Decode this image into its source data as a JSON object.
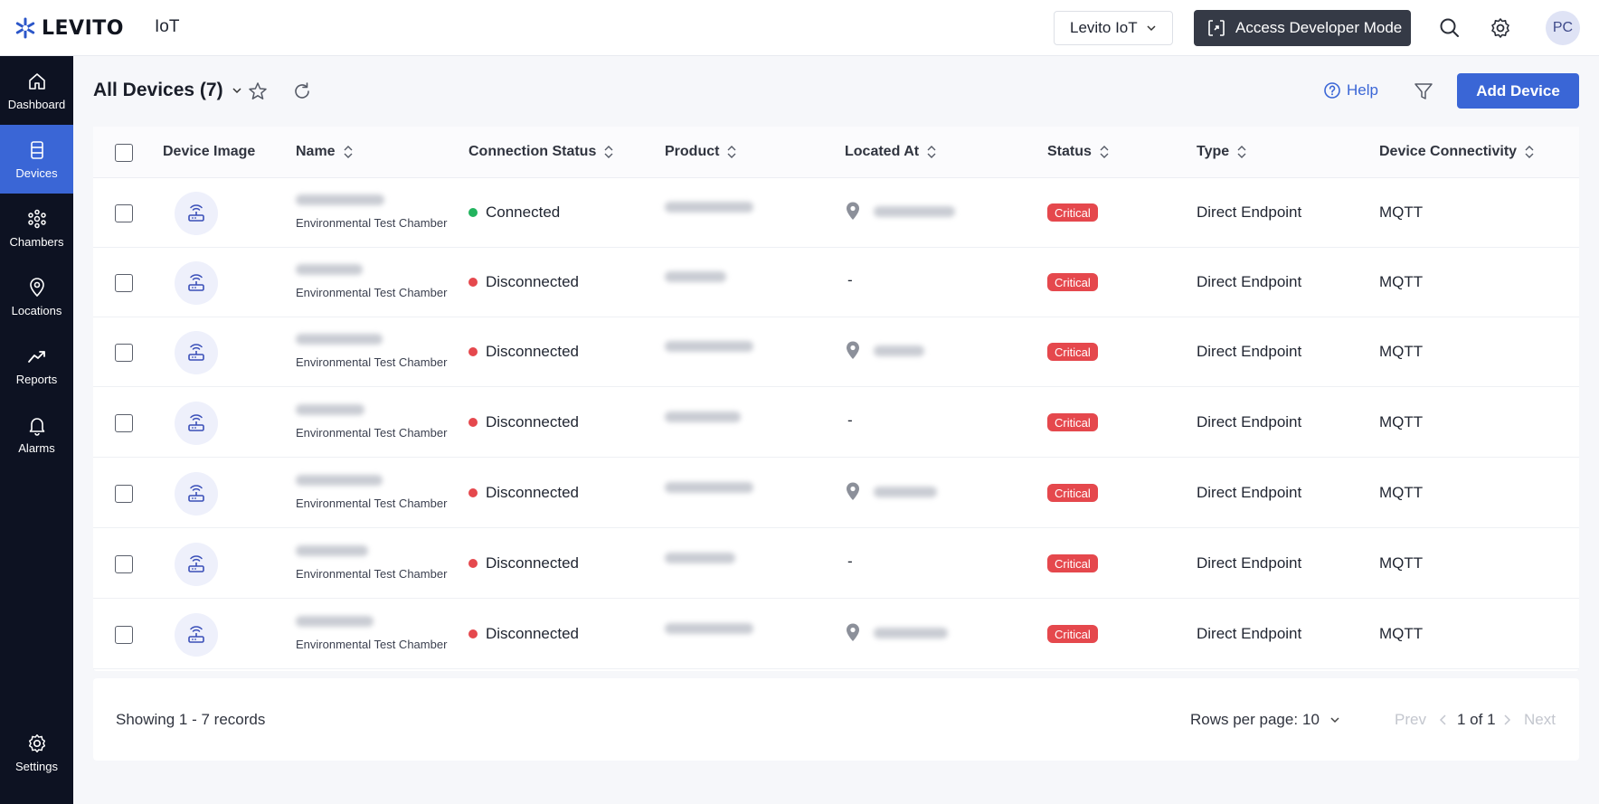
{
  "brand": {
    "logo_text": "LEVITO",
    "app_name": "IoT"
  },
  "topbar": {
    "org_select": "Levito IoT",
    "dev_mode_label": "Access Developer Mode",
    "avatar_initials": "PC"
  },
  "sidebar": {
    "items": [
      {
        "label": "Dashboard",
        "icon": "home-icon"
      },
      {
        "label": "Devices",
        "icon": "devices-icon",
        "active": true
      },
      {
        "label": "Chambers",
        "icon": "chambers-icon"
      },
      {
        "label": "Locations",
        "icon": "location-pin-icon"
      },
      {
        "label": "Reports",
        "icon": "trend-icon"
      },
      {
        "label": "Alarms",
        "icon": "bell-icon"
      }
    ],
    "settings_label": "Settings"
  },
  "header": {
    "title": "All Devices (7)",
    "help_label": "Help",
    "add_button": "Add Device"
  },
  "table": {
    "columns": [
      "Device Image",
      "Name",
      "Connection Status",
      "Product",
      "Located At",
      "Status",
      "Type",
      "Device Connectivity"
    ],
    "rows": [
      {
        "name_sub": "Environmental Test Chamber",
        "connection": "Connected",
        "connected": true,
        "located": "pin",
        "status": "Critical",
        "type": "Direct Endpoint",
        "connectivity": "MQTT"
      },
      {
        "name_sub": "Environmental Test Chamber",
        "connection": "Disconnected",
        "connected": false,
        "located": "-",
        "status": "Critical",
        "type": "Direct Endpoint",
        "connectivity": "MQTT"
      },
      {
        "name_sub": "Environmental Test Chamber",
        "connection": "Disconnected",
        "connected": false,
        "located": "pin",
        "status": "Critical",
        "type": "Direct Endpoint",
        "connectivity": "MQTT"
      },
      {
        "name_sub": "Environmental Test Chamber",
        "connection": "Disconnected",
        "connected": false,
        "located": "-",
        "status": "Critical",
        "type": "Direct Endpoint",
        "connectivity": "MQTT"
      },
      {
        "name_sub": "Environmental Test Chamber",
        "connection": "Disconnected",
        "connected": false,
        "located": "pin",
        "status": "Critical",
        "type": "Direct Endpoint",
        "connectivity": "MQTT"
      },
      {
        "name_sub": "Environmental Test Chamber",
        "connection": "Disconnected",
        "connected": false,
        "located": "-",
        "status": "Critical",
        "type": "Direct Endpoint",
        "connectivity": "MQTT"
      },
      {
        "name_sub": "Environmental Test Chamber",
        "connection": "Disconnected",
        "connected": false,
        "located": "pin",
        "status": "Critical",
        "type": "Direct Endpoint",
        "connectivity": "MQTT"
      }
    ]
  },
  "footer": {
    "showing": "Showing 1 - 7 records",
    "rows_per_page_label": "Rows per page:",
    "rows_per_page_value": "10",
    "prev_label": "Prev",
    "page_info": "1 of 1",
    "next_label": "Next"
  },
  "colors": {
    "accent": "#3a66d6",
    "sidebar_bg": "#0d1222",
    "connected": "#22b35e",
    "disconnected": "#e5484d",
    "critical": "#e5484d"
  }
}
